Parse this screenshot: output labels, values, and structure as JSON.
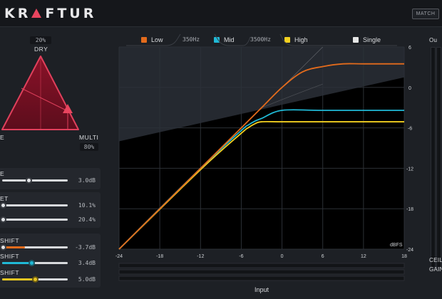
{
  "header": {
    "brand": "KRAFTUR",
    "match_label": "MATCH"
  },
  "left": {
    "dry_readout": "20%",
    "dry_label": "DRY",
    "left_label": "E",
    "multi_label": "MULTI",
    "multi_readout": "80%",
    "controls": [
      {
        "label": "E",
        "value": "3.0dB",
        "pos": 0.38
      },
      {
        "label": "ET",
        "value": "10.1%",
        "pos": 0.06
      },
      {
        "label": "",
        "value": "20.4%",
        "pos": 0.06
      },
      {
        "label": "SHIFT",
        "value": "-3.7dB",
        "pos": 0.05,
        "color": "#e36b1c"
      },
      {
        "label": "SHIFT",
        "value": "3.4dB",
        "pos": 0.55,
        "color": "#20b9d6"
      },
      {
        "label": "SHIFT",
        "value": "5.0dB",
        "pos": 0.62,
        "color": "#e6c523"
      }
    ]
  },
  "legend": [
    {
      "name": "Low",
      "color": "#e36b1c"
    },
    {
      "name": "Mid",
      "color": "#20b9d6"
    },
    {
      "name": "High",
      "color": "#f2d020"
    },
    {
      "name": "Single",
      "color": "#e6e6e6"
    }
  ],
  "crossover": {
    "low_mid": "350Hz",
    "mid_high": "3500Hz"
  },
  "chart_data": {
    "type": "line",
    "xlabel": "Input",
    "ylabel_unit": "dBFS",
    "x_ticks": [
      "-24",
      "-18",
      "-12",
      "-6",
      "0",
      "6",
      "12",
      "18"
    ],
    "y_ticks": [
      "6",
      "0",
      "-6",
      "-12",
      "-18",
      "-24"
    ],
    "xlim": [
      -24,
      18
    ],
    "ylim": [
      -24,
      6
    ],
    "series": [
      {
        "name": "Low",
        "color": "#e36b1c",
        "x": [
          -24,
          -6,
          -3,
          0,
          3,
          6,
          9,
          12,
          18
        ],
        "y": [
          -24,
          -6,
          -3,
          0,
          2.3,
          3.1,
          3.5,
          3.5,
          3.5
        ]
      },
      {
        "name": "Mid",
        "color": "#20b9d6",
        "x": [
          -24,
          -12,
          -6,
          -5,
          -4,
          -3,
          0,
          6,
          18
        ],
        "y": [
          -24,
          -12,
          -6.4,
          -5.6,
          -5.0,
          -4.6,
          -3.4,
          -3.4,
          -3.4
        ]
      },
      {
        "name": "High",
        "color": "#f2d020",
        "x": [
          -24,
          -12,
          -6,
          -5,
          -4,
          -3,
          0,
          6,
          18
        ],
        "y": [
          -24,
          -12.2,
          -6.8,
          -6.0,
          -5.4,
          -5.1,
          -5.1,
          -5.1,
          -5.1
        ]
      },
      {
        "name": "Single",
        "color": "#e6e6e6",
        "x": [
          -24,
          -6,
          0,
          6,
          12,
          18
        ],
        "y": [
          -24,
          -6,
          -0.3,
          0.4,
          0.5,
          0.5
        ]
      }
    ]
  },
  "right": {
    "top_label": "Ou",
    "ceil_label": "CEIL",
    "gain_label": "GAIN"
  }
}
